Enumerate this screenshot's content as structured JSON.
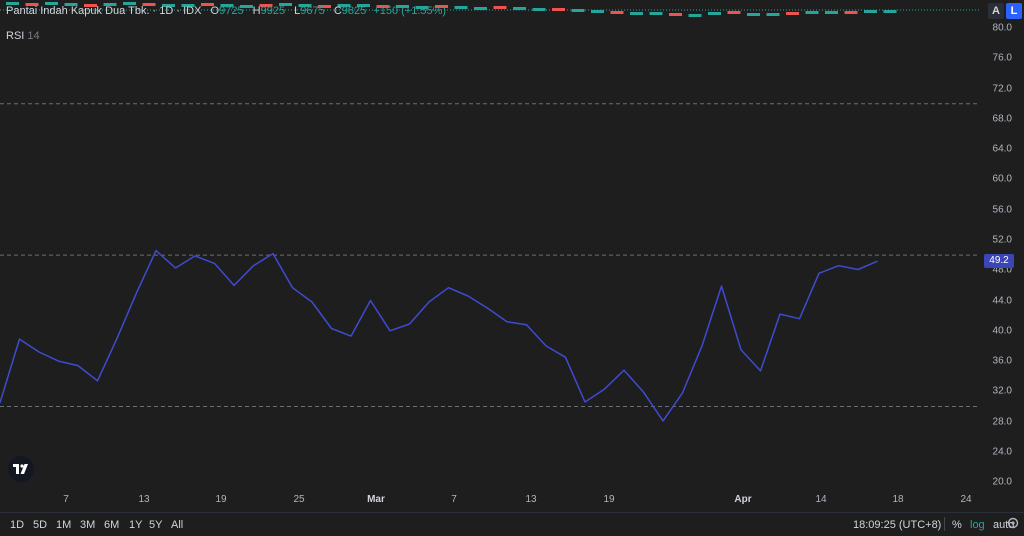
{
  "legend": {
    "symbol": "Pantai Indah Kapuk Dua Tbk. · 1D · IDX",
    "open_label": "O",
    "open": "9725",
    "high_label": "H",
    "high": "9925",
    "low_label": "L",
    "low": "9675",
    "close_label": "C",
    "close": "9825",
    "change": "+150 (+1.55%)"
  },
  "indicator": {
    "name": "RSI",
    "param": "14"
  },
  "toolbar": {
    "auto_scale": "A",
    "lock_scale": "L"
  },
  "y_axis": {
    "ticks": [
      "80.0",
      "76.0",
      "72.0",
      "68.0",
      "64.0",
      "60.0",
      "56.0",
      "52.0",
      "48.0",
      "44.0",
      "40.0",
      "36.0",
      "32.0",
      "28.0",
      "24.0",
      "20.0"
    ],
    "current_value": "49.2"
  },
  "x_axis": {
    "ticks": [
      {
        "label": "7",
        "bold": false
      },
      {
        "label": "13",
        "bold": false
      },
      {
        "label": "19",
        "bold": false
      },
      {
        "label": "25",
        "bold": false
      },
      {
        "label": "Mar",
        "bold": true
      },
      {
        "label": "7",
        "bold": false
      },
      {
        "label": "13",
        "bold": false
      },
      {
        "label": "19",
        "bold": false
      },
      {
        "label": "Apr",
        "bold": true
      },
      {
        "label": "14",
        "bold": false
      },
      {
        "label": "18",
        "bold": false
      },
      {
        "label": "24",
        "bold": false
      }
    ]
  },
  "bottom_bar": {
    "ranges": [
      "1D",
      "5D",
      "1M",
      "3M",
      "6M",
      "1Y",
      "5Y",
      "All"
    ],
    "time": "18:09:25 (UTC+8)",
    "percent": "%",
    "log": "log",
    "auto": "auto"
  },
  "colors": {
    "rsi_line": "#3f4bd0",
    "up": "#26a69a",
    "down": "#ef5350",
    "badge": "#3b45b5"
  },
  "chart_data": {
    "type": "line",
    "title": "RSI 14",
    "series": [
      {
        "name": "RSI",
        "values": [
          30.5,
          38.9,
          37.2,
          36.0,
          35.4,
          33.4,
          39.0,
          45.0,
          50.6,
          48.3,
          49.9,
          48.9,
          46.0,
          48.6,
          50.2,
          45.7,
          43.8,
          40.3,
          39.3,
          44.0,
          40.0,
          40.9,
          43.8,
          45.7,
          44.6,
          43.0,
          41.2,
          40.8,
          38.0,
          36.5,
          30.6,
          32.3,
          34.8,
          31.9,
          28.1,
          31.8,
          38.0,
          45.9,
          37.5,
          34.7,
          42.2,
          41.6,
          47.6,
          48.6,
          48.1,
          49.2
        ]
      }
    ],
    "ylim": [
      19,
      81
    ],
    "reference_lines": [
      70,
      50,
      30
    ],
    "grid": false
  }
}
